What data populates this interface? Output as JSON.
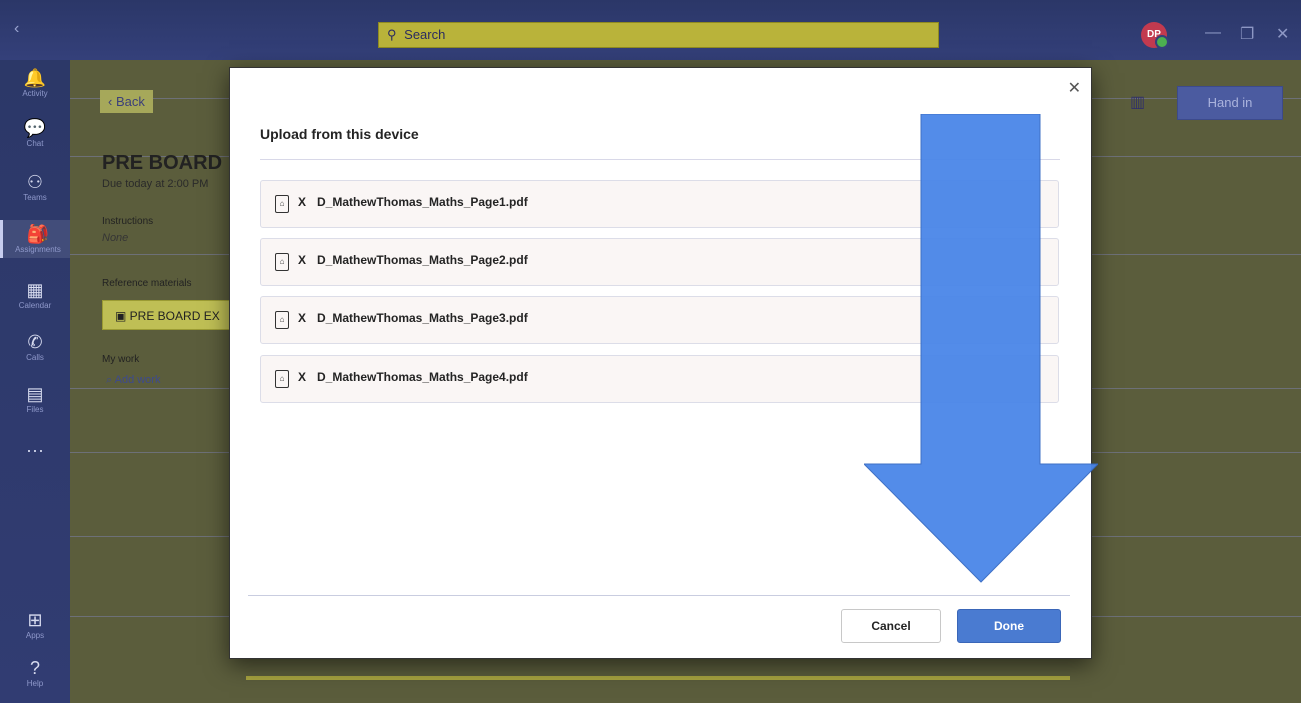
{
  "titlebar": {
    "search_placeholder": "Search",
    "avatar_initials": "DP",
    "window_controls": [
      "—",
      "❐",
      "✕"
    ]
  },
  "rail": {
    "items": [
      {
        "label": "Activity",
        "icon": "bell-icon",
        "glyph": "🔔"
      },
      {
        "label": "Chat",
        "icon": "chat-icon",
        "glyph": "💬"
      },
      {
        "label": "Teams",
        "icon": "teams-icon",
        "glyph": "⚇"
      },
      {
        "label": "Assignments",
        "icon": "assignments-icon",
        "glyph": "🎒"
      },
      {
        "label": "Calendar",
        "icon": "calendar-icon",
        "glyph": "▦"
      },
      {
        "label": "Calls",
        "icon": "phone-icon",
        "glyph": "✆"
      },
      {
        "label": "Files",
        "icon": "files-icon",
        "glyph": "▤"
      },
      {
        "label": "",
        "icon": "more-icon",
        "glyph": "···"
      },
      {
        "label": "Apps",
        "icon": "apps-icon",
        "glyph": "⊞"
      },
      {
        "label": "Help",
        "icon": "help-icon",
        "glyph": "?"
      }
    ]
  },
  "page": {
    "back_label": "Back",
    "title": "PRE BOARD",
    "due": "Due today at 2:00 PM",
    "instructions_label": "Instructions",
    "instructions_value": "None",
    "reference_label": "Reference materials",
    "reference_item": "PRE BOARD EX",
    "my_work_label": "My work",
    "add_work_label": "Add work",
    "hand_in_label": "Hand in"
  },
  "modal": {
    "title": "Upload from this device",
    "files": [
      "D_MathewThomas_Maths_Page1.pdf",
      "D_MathewThomas_Maths_Page2.pdf",
      "D_MathewThomas_Maths_Page3.pdf",
      "D_MathewThomas_Maths_Page4.pdf"
    ],
    "remove_symbol": "X",
    "cancel_label": "Cancel",
    "done_label": "Done"
  },
  "colors": {
    "accent": "#4a7bd1",
    "arrow": "#4a86e8",
    "rail_bg": "#2e3a6c"
  }
}
